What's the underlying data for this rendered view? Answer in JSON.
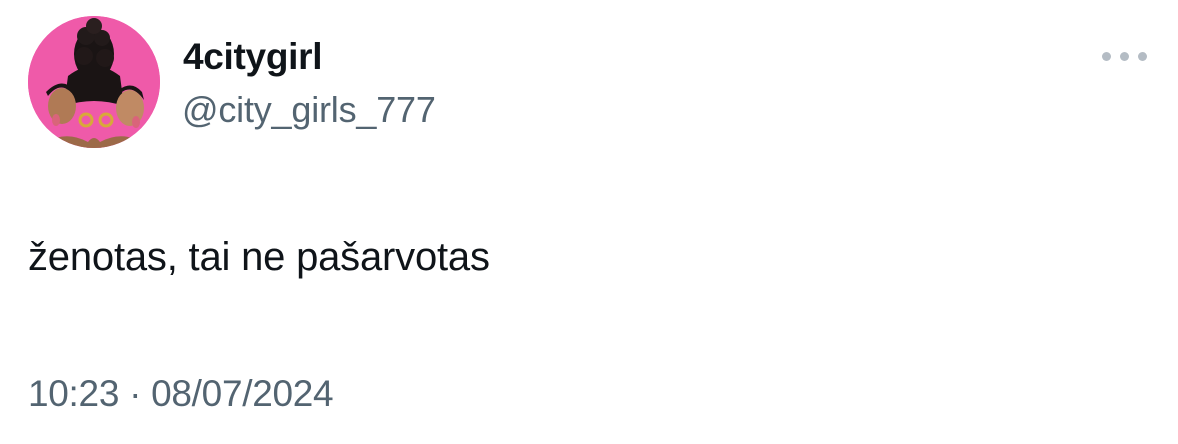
{
  "tweet": {
    "author": {
      "display_name": "4citygirl",
      "handle": "@city_girls_777",
      "avatar_icon": "profile-avatar-image"
    },
    "more_icon": "ellipsis-icon",
    "text": "ženotas, tai ne pašarvotas",
    "time": "10:23",
    "separator": "·",
    "date": "08/07/2024"
  },
  "colors": {
    "primary_text": "#0f1419",
    "secondary_text": "#536471",
    "avatar_bg": "#ef5aa9",
    "more_dots": "#b4bcc4"
  }
}
